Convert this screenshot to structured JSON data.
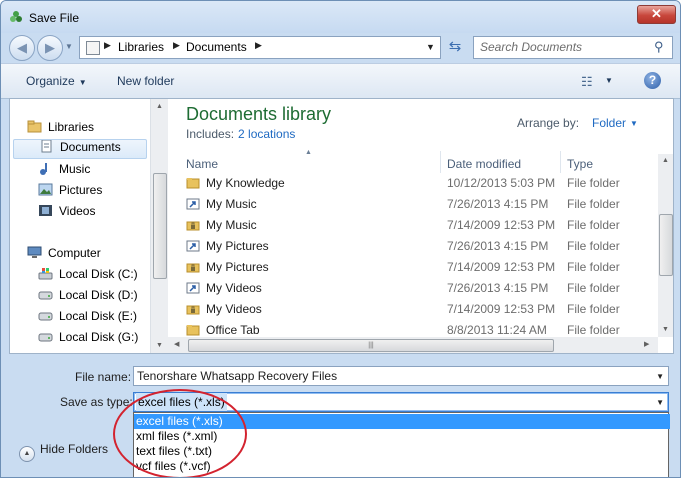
{
  "window": {
    "title": "Save File",
    "close_glyph": "✕"
  },
  "address_bar": {
    "crumbs": [
      "Libraries",
      "Documents"
    ],
    "search_placeholder": "Search Documents"
  },
  "toolbar": {
    "organize_label": "Organize",
    "new_folder_label": "New folder"
  },
  "nav_pane": {
    "items": [
      {
        "label": "Libraries",
        "icon": "libraries-icon"
      },
      {
        "label": "Documents",
        "icon": "documents-icon",
        "selected": true
      },
      {
        "label": "Music",
        "icon": "music-icon"
      },
      {
        "label": "Pictures",
        "icon": "pictures-icon"
      },
      {
        "label": "Videos",
        "icon": "videos-icon"
      },
      {
        "label": "Computer",
        "icon": "computer-icon"
      },
      {
        "label": "Local Disk (C:)",
        "icon": "windows-drive-icon"
      },
      {
        "label": "Local Disk (D:)",
        "icon": "drive-icon"
      },
      {
        "label": "Local Disk (E:)",
        "icon": "drive-icon"
      },
      {
        "label": "Local Disk (G:)",
        "icon": "drive-icon"
      }
    ]
  },
  "library": {
    "title": "Documents library",
    "includes_label": "Includes:",
    "includes_link": "2 locations",
    "arrange_label": "Arrange by:",
    "arrange_value": "Folder"
  },
  "file_list": {
    "columns": [
      "Name",
      "Date modified",
      "Type"
    ],
    "rows": [
      {
        "name": "My Knowledge",
        "date": "10/12/2013 5:03 PM",
        "type": "File folder",
        "icon": "folder-icon"
      },
      {
        "name": "My Music",
        "date": "7/26/2013 4:15 PM",
        "type": "File folder",
        "icon": "shortcut-folder-icon"
      },
      {
        "name": "My Music",
        "date": "7/14/2009 12:53 PM",
        "type": "File folder",
        "icon": "locked-folder-icon"
      },
      {
        "name": "My Pictures",
        "date": "7/26/2013 4:15 PM",
        "type": "File folder",
        "icon": "shortcut-folder-icon"
      },
      {
        "name": "My Pictures",
        "date": "7/14/2009 12:53 PM",
        "type": "File folder",
        "icon": "locked-folder-icon"
      },
      {
        "name": "My Videos",
        "date": "7/26/2013 4:15 PM",
        "type": "File folder",
        "icon": "shortcut-folder-icon"
      },
      {
        "name": "My Videos",
        "date": "7/14/2009 12:53 PM",
        "type": "File folder",
        "icon": "locked-folder-icon"
      },
      {
        "name": "Office Tab",
        "date": "8/8/2013 11:24 AM",
        "type": "File folder",
        "icon": "folder-icon"
      }
    ]
  },
  "form": {
    "file_name_label": "File name:",
    "file_name_value": "Tenorshare Whatsapp Recovery Files",
    "save_as_type_label": "Save as type:",
    "save_as_type_value": "excel files (*.xls)",
    "type_options": [
      "excel files (*.xls)",
      "xml files (*.xml)",
      "text files (*.txt)",
      "vcf files (*.vcf)"
    ]
  },
  "footer": {
    "hide_folders_label": "Hide Folders"
  },
  "colors": {
    "library_title": "#1e6c33",
    "link": "#1f6ac2",
    "selected_option": "#3399ff",
    "annotation": "#d3232f"
  }
}
